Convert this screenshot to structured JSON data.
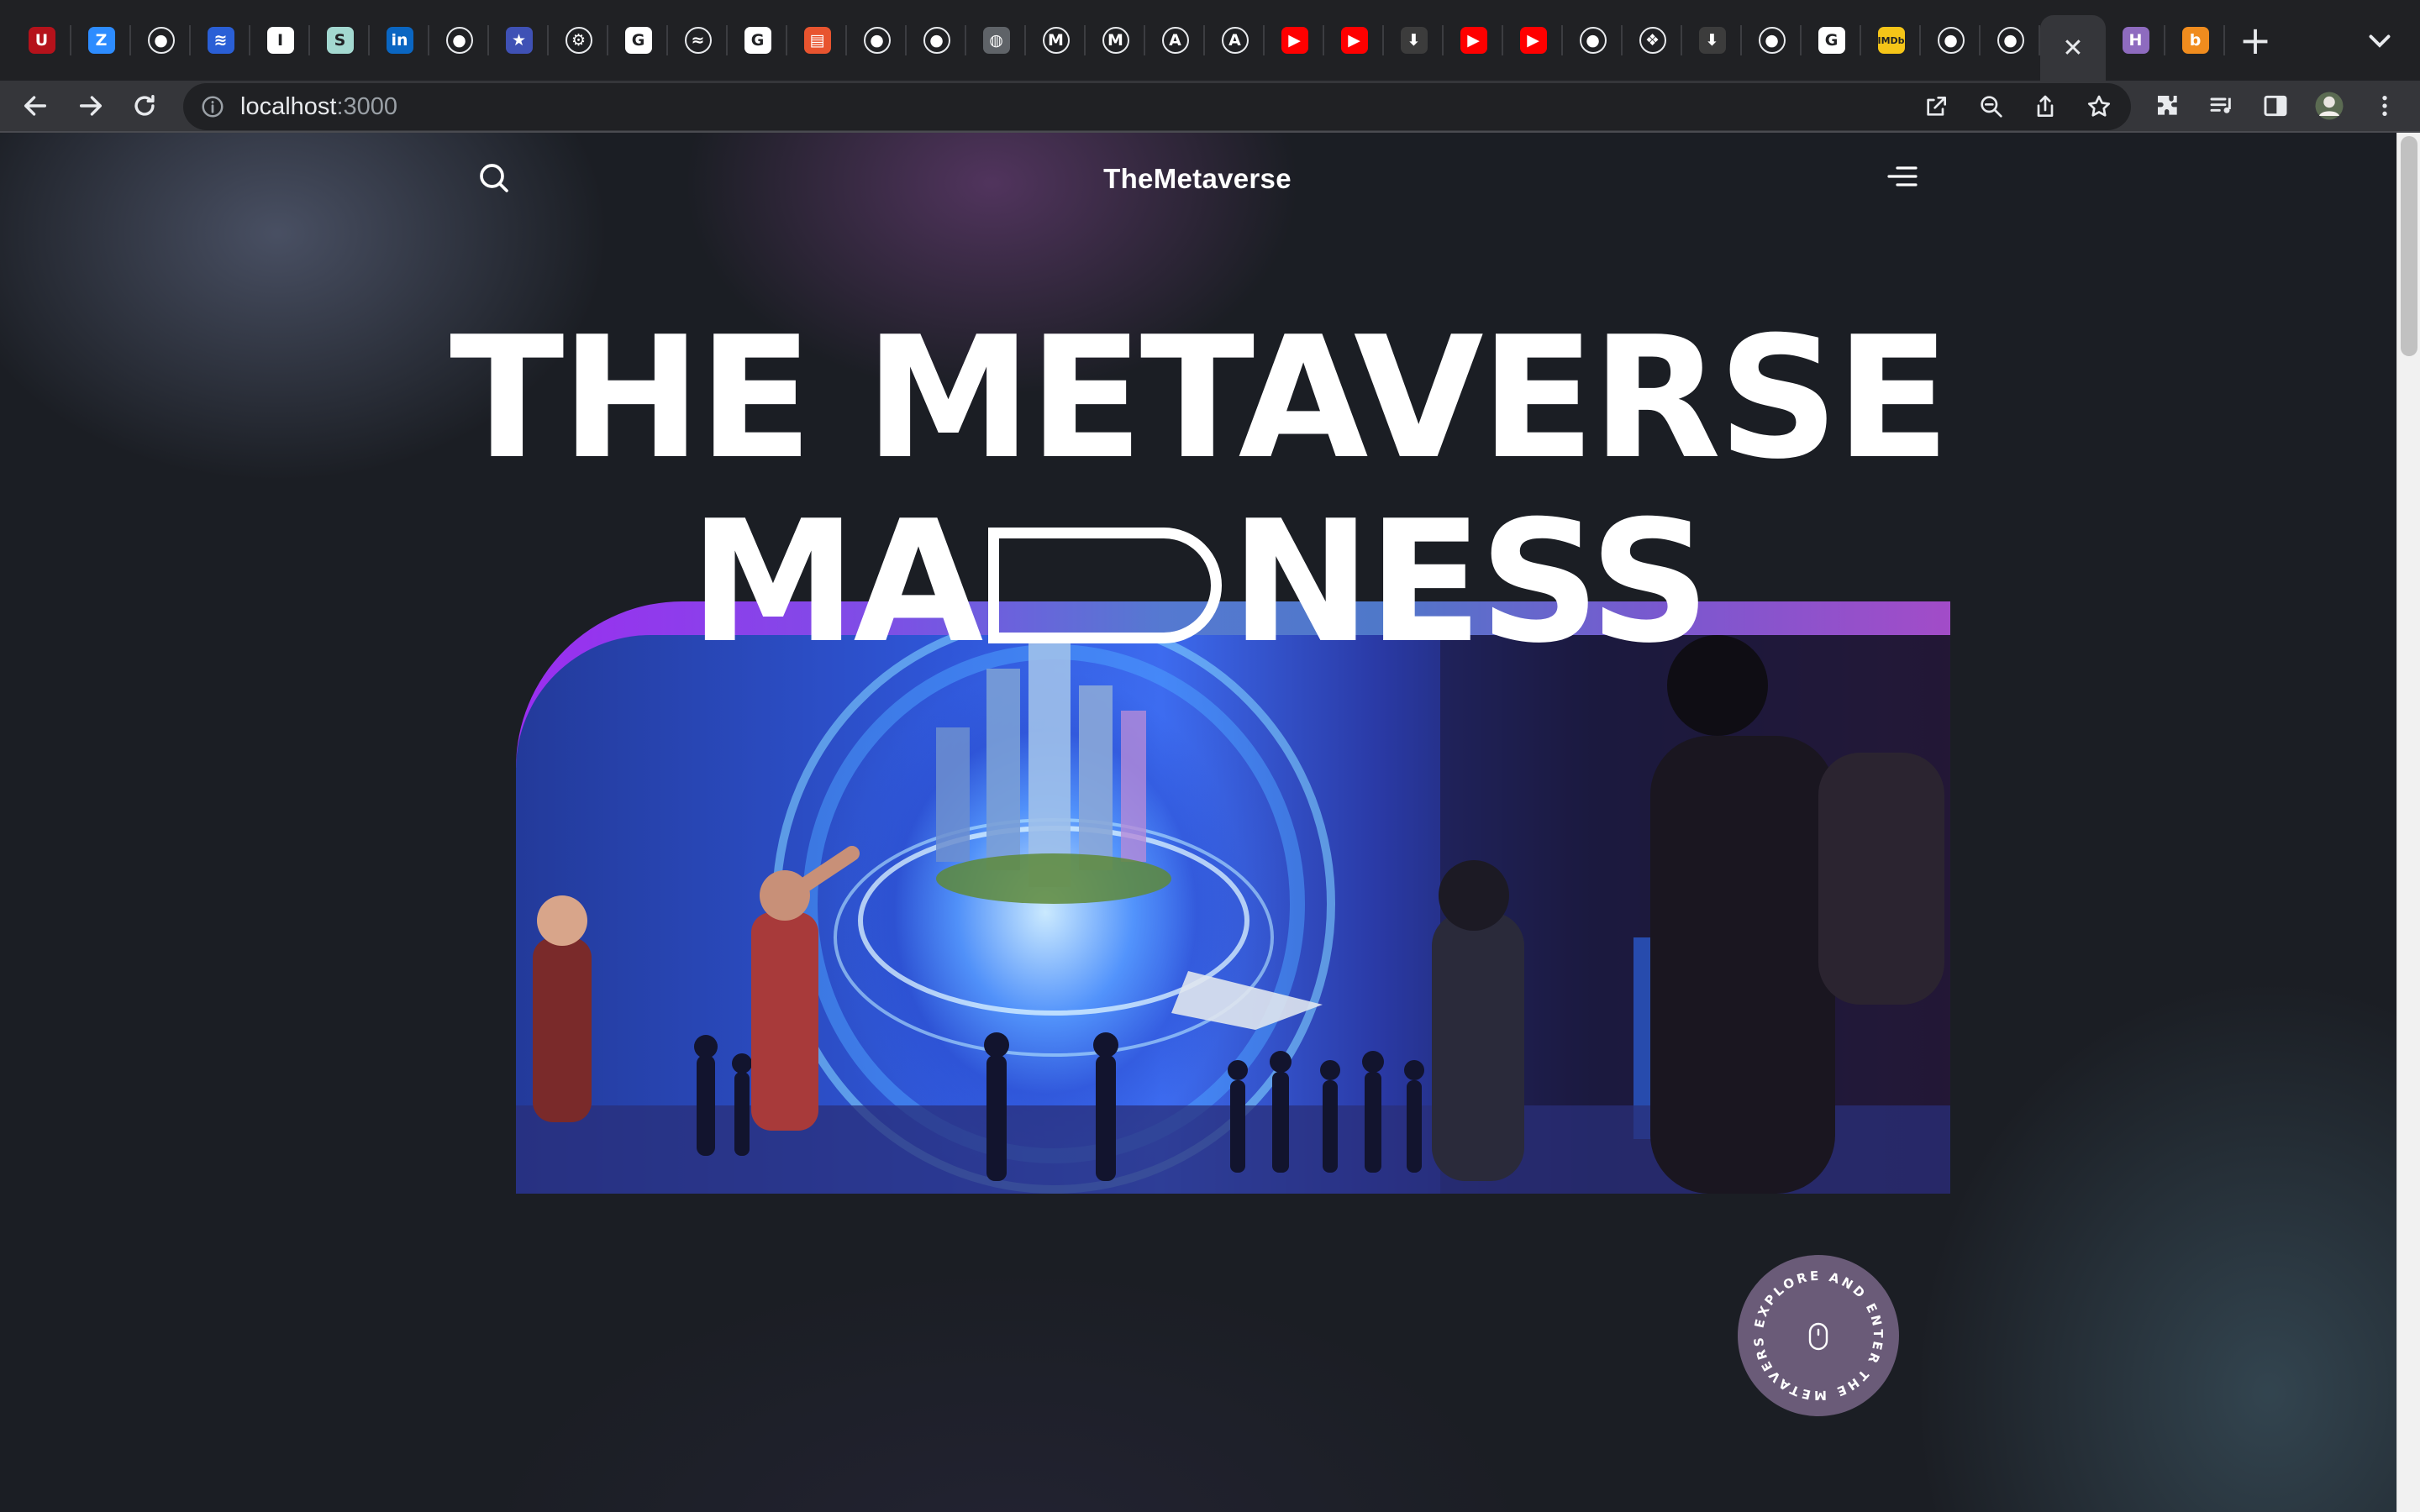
{
  "browser": {
    "tabs": [
      {
        "icon": "utah-icon",
        "glyph": "U",
        "color": "#b5121b"
      },
      {
        "icon": "zoom-icon",
        "glyph": "Z",
        "color": "#2d8cff"
      },
      {
        "icon": "github-icon",
        "glyph": "●",
        "color": "#202124"
      },
      {
        "icon": "cloud-icon",
        "glyph": "≋",
        "color": "#2a5fd6"
      },
      {
        "icon": "doc-icon",
        "glyph": "I",
        "color": "#ffffff"
      },
      {
        "icon": "s-icon",
        "glyph": "S",
        "color": "#a3d8d0"
      },
      {
        "icon": "linkedin-icon",
        "glyph": "in",
        "color": "#0a66c2"
      },
      {
        "icon": "github-icon",
        "glyph": "●",
        "color": "#202124"
      },
      {
        "icon": "star-badge-icon",
        "glyph": "★",
        "color": "#3f51b5"
      },
      {
        "icon": "gear-icon",
        "glyph": "⚙",
        "color": "#202124"
      },
      {
        "icon": "google-icon",
        "glyph": "G",
        "color": "#ffffff"
      },
      {
        "icon": "tailwind-icon",
        "glyph": "≈",
        "color": "#202124"
      },
      {
        "icon": "google-icon",
        "glyph": "G",
        "color": "#ffffff"
      },
      {
        "icon": "trello-icon",
        "glyph": "▤",
        "color": "#e8542f"
      },
      {
        "icon": "github-icon",
        "glyph": "●",
        "color": "#202124"
      },
      {
        "icon": "github-icon",
        "glyph": "●",
        "color": "#202124"
      },
      {
        "icon": "globe-icon",
        "glyph": "◍",
        "color": "#5f6368"
      },
      {
        "icon": "medium-icon",
        "glyph": "M",
        "color": "#202124"
      },
      {
        "icon": "medium-icon",
        "glyph": "M",
        "color": "#202124"
      },
      {
        "icon": "a-circle-icon",
        "glyph": "A",
        "color": "#202124"
      },
      {
        "icon": "a-circle-icon",
        "glyph": "A",
        "color": "#202124"
      },
      {
        "icon": "youtube-icon",
        "glyph": "▶",
        "color": "#ff0000"
      },
      {
        "icon": "youtube-icon",
        "glyph": "▶",
        "color": "#ff0000"
      },
      {
        "icon": "download-icon",
        "glyph": "⬇",
        "color": "#3c3c3c"
      },
      {
        "icon": "youtube-icon",
        "glyph": "▶",
        "color": "#ff0000"
      },
      {
        "icon": "youtube-icon",
        "glyph": "▶",
        "color": "#ff0000"
      },
      {
        "icon": "github-icon",
        "glyph": "●",
        "color": "#202124"
      },
      {
        "icon": "figma-icon",
        "glyph": "❖",
        "color": "#202124"
      },
      {
        "icon": "download-icon",
        "glyph": "⬇",
        "color": "#3c3c3c"
      },
      {
        "icon": "github-icon",
        "glyph": "●",
        "color": "#202124"
      },
      {
        "icon": "google-icon",
        "glyph": "G",
        "color": "#ffffff"
      },
      {
        "icon": "imdb-icon",
        "glyph": "IMDb",
        "color": "#f5c518"
      },
      {
        "icon": "github-icon",
        "glyph": "●",
        "color": "#202124"
      },
      {
        "icon": "github-icon",
        "glyph": "●",
        "color": "#202124"
      }
    ],
    "active_tab": {
      "icon": "close-icon",
      "glyph": "✕"
    },
    "after_tabs": [
      {
        "icon": "h-icon",
        "glyph": "H",
        "color": "#8e6bbf"
      },
      {
        "icon": "b-icon",
        "glyph": "b",
        "color": "#f08c1e"
      }
    ],
    "new_tab_glyph": "+",
    "url_host": "localhost",
    "url_port": ":3000"
  },
  "page": {
    "brand": "TheMetaverse",
    "hero_line1": "THE METAVERSE",
    "hero_line2_left": "MA",
    "hero_line2_right": "NESS",
    "explore_badge": "EXPLORE AND ENTER THE METAVERSE",
    "colors": {
      "accent_purple": "#9b2ef0",
      "accent_blue": "#4f78c9",
      "background": "#1b1e24"
    }
  }
}
